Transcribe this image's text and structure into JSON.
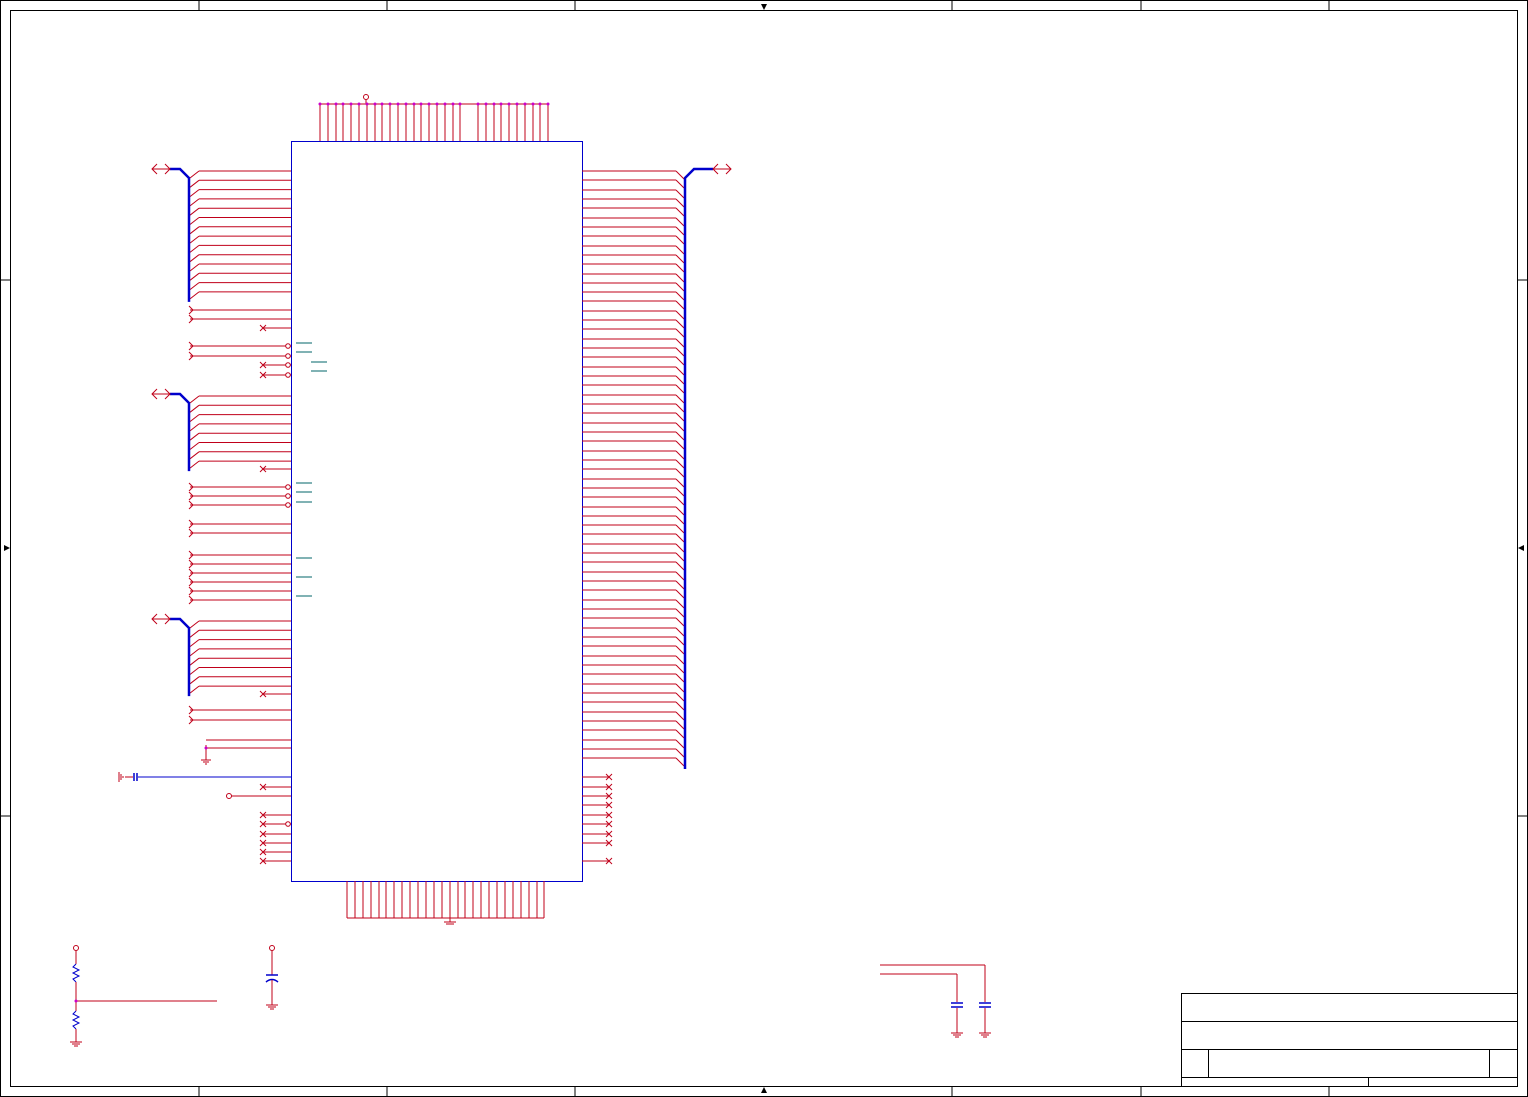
{
  "schematic": {
    "colors": {
      "frame": "#000000",
      "wire": "#c0001a",
      "bus": "#0000cc",
      "chip_outline": "#0000cc",
      "pin_magenta": "#cc00cc",
      "cap_blue": "#0000cc",
      "label_teal": "#00666a"
    },
    "icons": [
      "bidirectional-port-icon",
      "no-connect-icon",
      "ground-icon",
      "capacitor-icon",
      "resistor-icon",
      "power-pin-icon"
    ]
  }
}
